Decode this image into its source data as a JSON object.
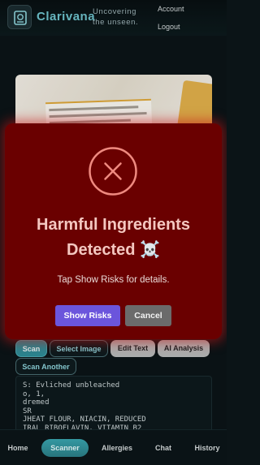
{
  "header": {
    "brand": "Clarivana",
    "tagline": "Uncovering the unseen.",
    "account_link": "Account",
    "logout_link": "Logout"
  },
  "actions": {
    "scan": "Scan",
    "select_image": "Select Image",
    "edit_text": "Edit Text",
    "ai_analysis": "AI Analysis",
    "scan_another": "Scan Another"
  },
  "ocr_text": "S: Evliched unbleached\no, 1,\ndremed\nSR\nJHEAT FLOUR, NIACIN, REDUCED\nIRAL RIBOFLAVIN, VITAMIN B2",
  "bottom_nav": [
    "Home",
    "Scanner",
    "Allergies",
    "Chat",
    "History"
  ],
  "active_tab": "Scanner",
  "modal": {
    "title": "Harmful Ingredients Detected ☠️",
    "subtitle": "Tap Show Risks for details.",
    "primary_button": "Show Risks",
    "secondary_button": "Cancel"
  },
  "colors": {
    "modal_bg": "#6a0000",
    "modal_glow": "#c81414",
    "primary_button": "#6b55dc",
    "accent": "#2f8f99"
  }
}
